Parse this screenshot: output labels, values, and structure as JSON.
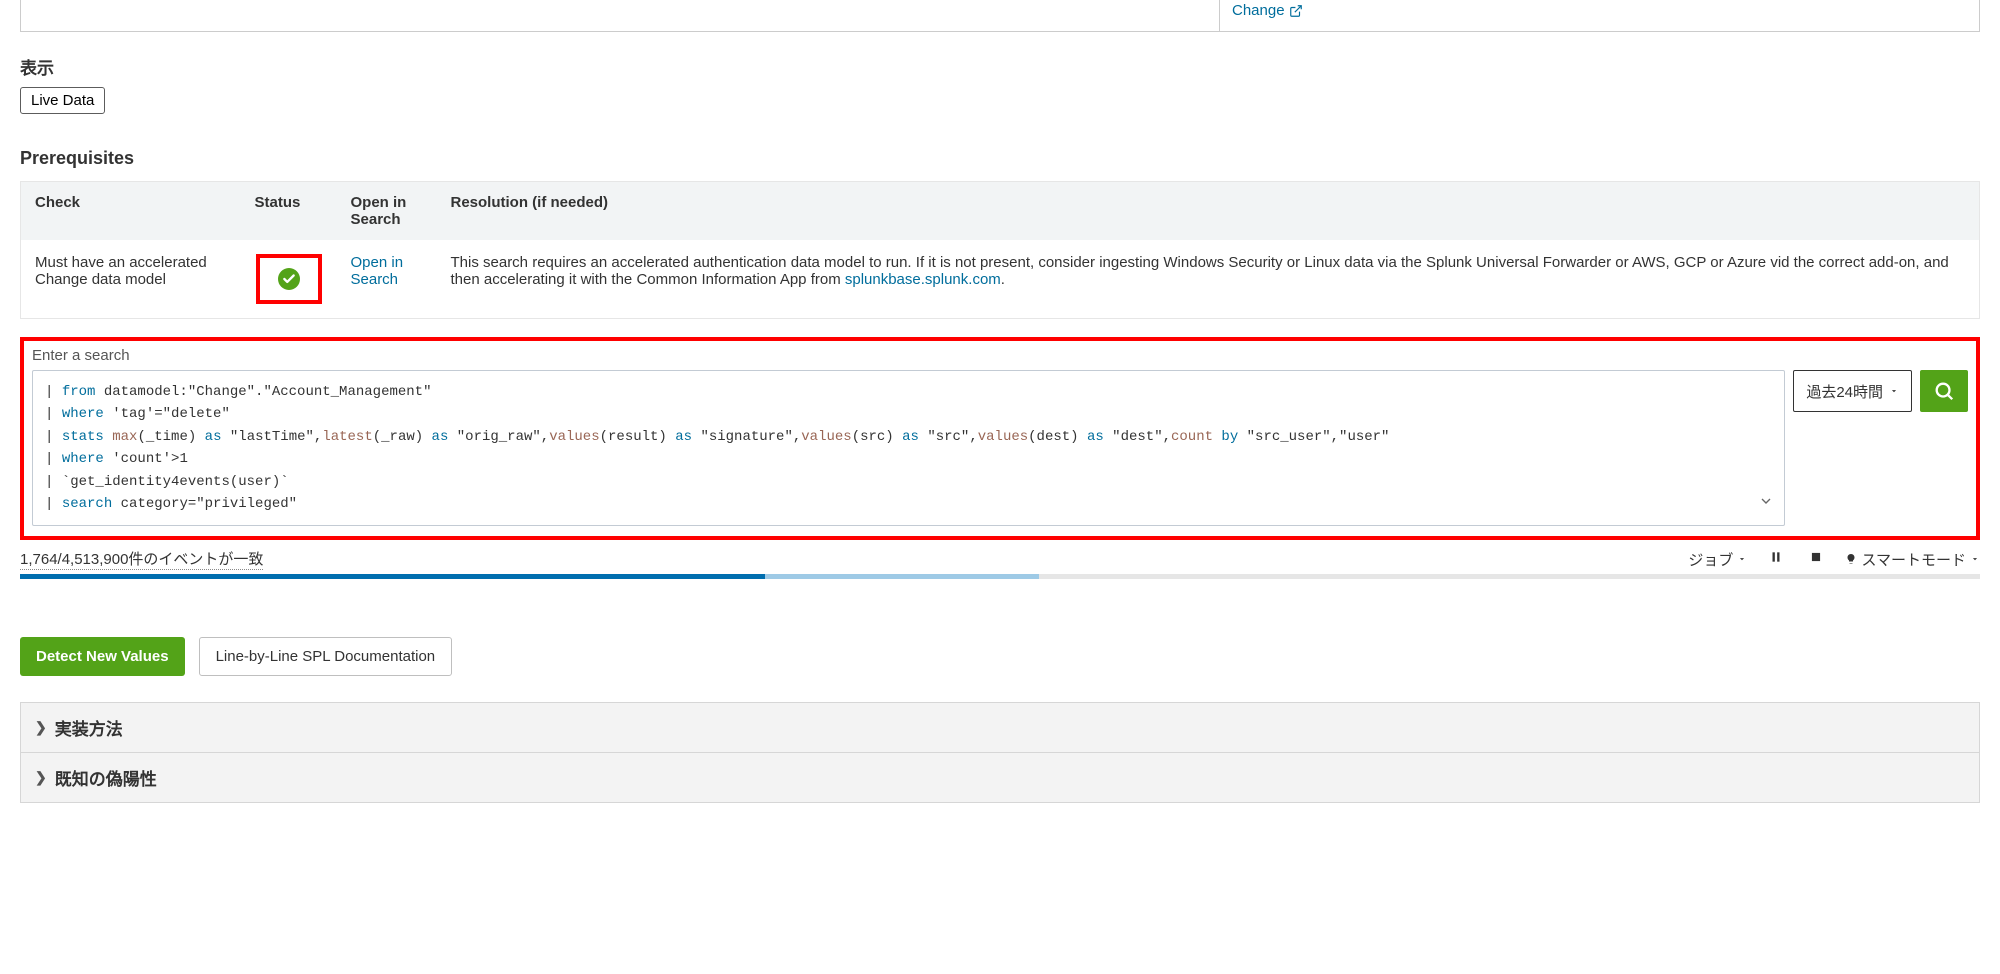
{
  "top_link": {
    "label": "Change"
  },
  "display_section": {
    "label": "表示",
    "button": "Live Data"
  },
  "prerequisites": {
    "title": "Prerequisites",
    "headers": {
      "check": "Check",
      "status": "Status",
      "openin": "Open in Search",
      "resolution": "Resolution (if needed)"
    },
    "row": {
      "check": "Must have an accelerated Change data model",
      "open_link": "Open in Search",
      "resolution_prefix": "This search requires an accelerated authentication data model to run. If it is not present, consider ingesting Windows Security or Linux data via the Splunk Universal Forwarder or AWS, GCP or Azure vid the correct add-on, and then accelerating it with the Common Information App from ",
      "resolution_link": "splunkbase.splunk.com",
      "resolution_suffix": "."
    }
  },
  "search": {
    "label": "Enter a search",
    "spl": {
      "l1": {
        "kw": "from",
        "rest": " datamodel:\"Change\".\"Account_Management\""
      },
      "l2": {
        "kw": "where",
        "rest": " 'tag'=\"delete\""
      },
      "l3": {
        "kw": "stats",
        "f1": "max",
        "a1": "(_time) ",
        "as1": "as",
        "s1": " \"lastTime\",",
        "f2": "latest",
        "a2": "(_raw) ",
        "as2": "as",
        "s2": " \"orig_raw\",",
        "f3": "values",
        "a3": "(result) ",
        "as3": "as",
        "s3": " \"signature\",",
        "f4": "values",
        "a4": "(src) ",
        "as4": "as",
        "s4": " \"src\",",
        "f5": "values",
        "a5": "(dest) ",
        "as5": "as",
        "s5": " \"dest\",",
        "f6": "count",
        "sp": " ",
        "by": "by",
        "s6": " \"src_user\",\"user\""
      },
      "l4": {
        "kw": "where",
        "rest": " 'count'>1"
      },
      "l5": {
        "rest": "`get_identity4events(user)`"
      },
      "l6": {
        "kw": "search",
        "rest": " category=\"privileged\""
      }
    },
    "time_label": "過去24時間"
  },
  "status_bar": {
    "events": "1,764/4,513,900件のイベントが一致",
    "job": "ジョブ",
    "smart": "スマートモード"
  },
  "buttons": {
    "detect": "Detect New Values",
    "docs": "Line-by-Line SPL Documentation"
  },
  "accordion": {
    "impl": "実装方法",
    "fp": "既知の偽陽性"
  }
}
